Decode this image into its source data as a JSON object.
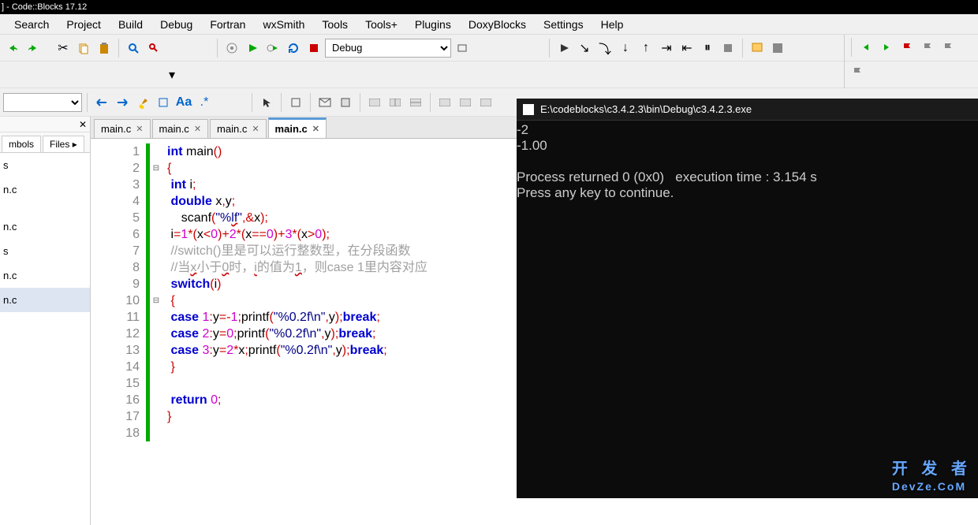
{
  "title": "] - Code::Blocks 17.12",
  "menu": [
    "Search",
    "Project",
    "Build",
    "Debug",
    "Fortran",
    "wxSmith",
    "Tools",
    "Tools+",
    "Plugins",
    "DoxyBlocks",
    "Settings",
    "Help"
  ],
  "debug_combo": "Debug",
  "sidebar": {
    "tabs": [
      "mbols",
      "Files"
    ],
    "items": [
      "s",
      "n.c",
      "",
      "n.c",
      "s",
      "n.c",
      "n.c"
    ],
    "selected": 6
  },
  "editor_tabs": [
    {
      "label": "main.c",
      "active": false
    },
    {
      "label": "main.c",
      "active": false
    },
    {
      "label": "main.c",
      "active": false
    },
    {
      "label": "main.c",
      "active": true
    }
  ],
  "code": {
    "lines": [
      {
        "n": 1,
        "html": "<span class='ty'>int</span> main<span class='op'>()</span>"
      },
      {
        "n": 2,
        "fold": "⊟",
        "html": "<span class='op'>{</span>"
      },
      {
        "n": 3,
        "html": " <span class='ty'>int</span> i<span class='op'>;</span>"
      },
      {
        "n": 4,
        "html": " <span class='ty'>double</span> x<span class='op'>,</span>y<span class='op'>;</span>"
      },
      {
        "n": 5,
        "html": "    scanf<span class='op'>(</span><span class='str'>\"%<span class='wavy'>lf</span>\"</span><span class='op'>,&amp;</span>x<span class='op'>);</span>"
      },
      {
        "n": 6,
        "html": " i<span class='op'>=</span><span class='num'>1</span><span class='op'>*(</span>x<span class='op'>&lt;</span><span class='num'>0</span><span class='op'>)+</span><span class='num'>2</span><span class='op'>*(</span>x<span class='op'>==</span><span class='num'>0</span><span class='op'>)+</span><span class='num'>3</span><span class='op'>*(</span>x<span class='op'>&gt;</span><span class='num'>0</span><span class='op'>);</span>"
      },
      {
        "n": 7,
        "html": " <span class='cmt'>//switch()里是可以运行整数型，在分段函数</span>"
      },
      {
        "n": 8,
        "html": " <span class='cmt'>//当<span class='wavy'>x</span>小于<span class='wavy'>0</span>时，<span class='wavy'>i</span>的值为<span class='wavy'>1</span>，则case 1里内容对应</span>"
      },
      {
        "n": 9,
        "html": " <span class='kw'>switch</span><span class='op'>(</span>i<span class='op'>)</span>"
      },
      {
        "n": 10,
        "fold": "⊟",
        "html": " <span class='op'>{</span>"
      },
      {
        "n": 11,
        "html": " <span class='kw'>case</span> <span class='num'>1</span><span class='op'>:</span>y<span class='op'>=-</span><span class='num'>1</span><span class='op'>;</span>printf<span class='op'>(</span><span class='str'>\"%0.2f\\n\"</span><span class='op'>,</span>y<span class='op'>);</span><span class='kw'>break</span><span class='op'>;</span>"
      },
      {
        "n": 12,
        "html": " <span class='kw'>case</span> <span class='num'>2</span><span class='op'>:</span>y<span class='op'>=</span><span class='num'>0</span><span class='op'>;</span>printf<span class='op'>(</span><span class='str'>\"%0.2f\\n\"</span><span class='op'>,</span>y<span class='op'>);</span><span class='kw'>break</span><span class='op'>;</span>"
      },
      {
        "n": 13,
        "html": " <span class='kw'>case</span> <span class='num'>3</span><span class='op'>:</span>y<span class='op'>=</span><span class='num'>2</span><span class='op'>*</span>x<span class='op'>;</span>printf<span class='op'>(</span><span class='str'>\"%0.2f\\n\"</span><span class='op'>,</span>y<span class='op'>);</span><span class='kw'>break</span><span class='op'>;</span>"
      },
      {
        "n": 14,
        "html": " <span class='op'>}</span>"
      },
      {
        "n": 15,
        "html": ""
      },
      {
        "n": 16,
        "html": " <span class='kw'>return</span> <span class='num'>0</span><span class='op'>;</span>"
      },
      {
        "n": 17,
        "html": "<span class='op'>}</span>"
      },
      {
        "n": 18,
        "html": ""
      }
    ]
  },
  "console": {
    "title": "E:\\codeblocks\\c3.4.2.3\\bin\\Debug\\c3.4.2.3.exe",
    "output": "-2\n-1.00\n\nProcess returned 0 (0x0)   execution time : 3.154 s\nPress any key to continue."
  },
  "watermark": {
    "line1": "开 发 者",
    "line2": "DevZe.CoM"
  }
}
